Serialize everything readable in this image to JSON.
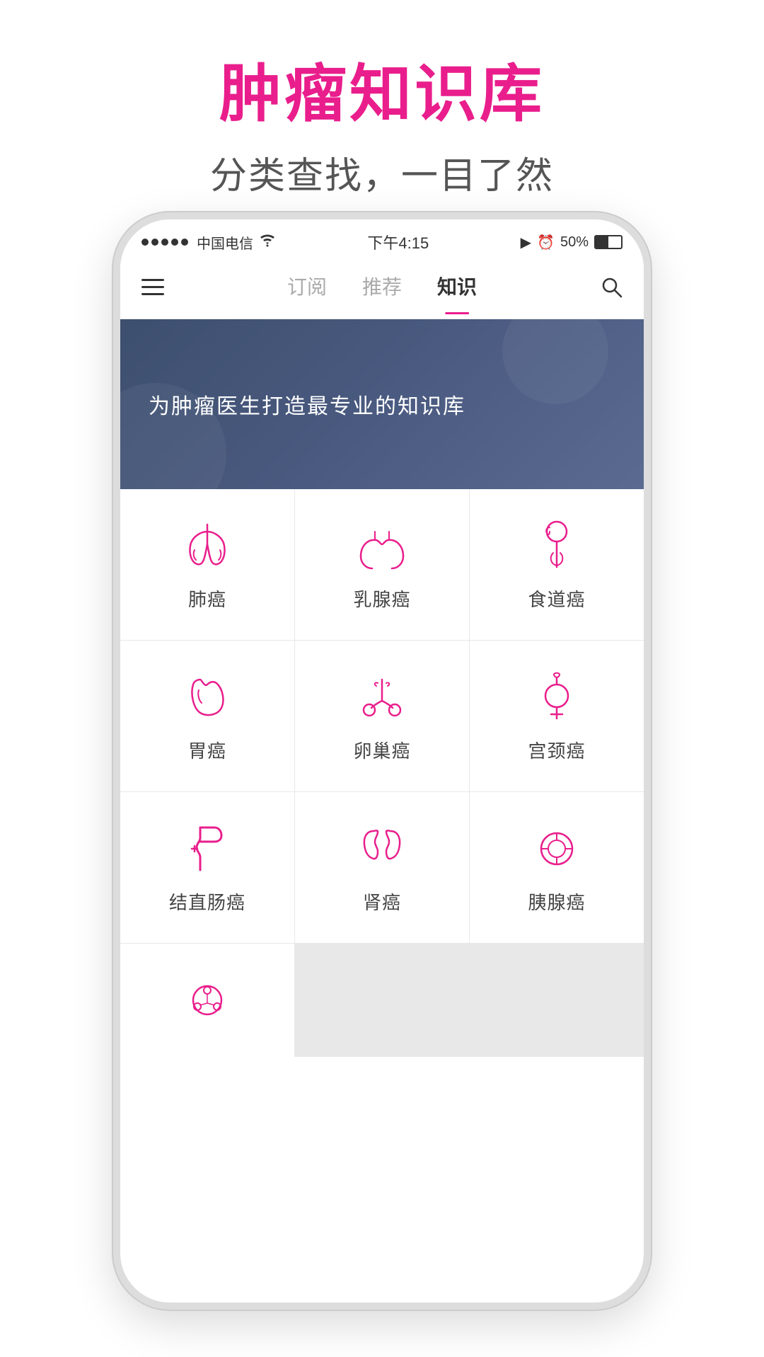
{
  "page": {
    "title_main": "肿瘤知识库",
    "title_sub": "分类查找，一目了然"
  },
  "status_bar": {
    "carrier": "中国电信",
    "time": "下午4:15",
    "battery": "50%"
  },
  "nav": {
    "tabs": [
      {
        "label": "订阅",
        "active": false
      },
      {
        "label": "推荐",
        "active": false
      },
      {
        "label": "知识",
        "active": true
      }
    ]
  },
  "banner": {
    "text": "为肿瘤医生打造最专业的知识库"
  },
  "grid_items": [
    {
      "id": "lung",
      "label": "肺癌"
    },
    {
      "id": "breast",
      "label": "乳腺癌"
    },
    {
      "id": "esophagus",
      "label": "食道癌"
    },
    {
      "id": "stomach",
      "label": "胃癌"
    },
    {
      "id": "ovary",
      "label": "卵巢癌"
    },
    {
      "id": "cervix",
      "label": "宫颈癌"
    },
    {
      "id": "colon",
      "label": "结直肠癌"
    },
    {
      "id": "kidney",
      "label": "肾癌"
    },
    {
      "id": "pancreas",
      "label": "胰腺癌"
    },
    {
      "id": "unknown",
      "label": ""
    }
  ],
  "colors": {
    "accent": "#e91e8c",
    "nav_active": "#333",
    "nav_inactive": "#aaa"
  }
}
